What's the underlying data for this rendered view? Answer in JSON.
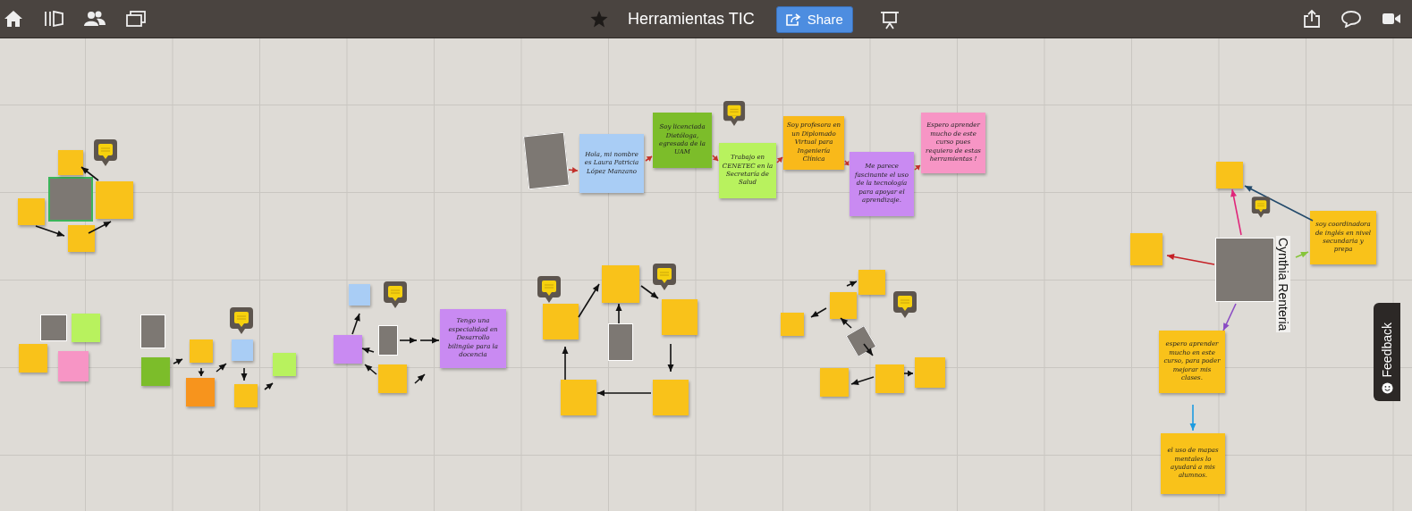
{
  "toolbar": {
    "title": "Herramientas TIC",
    "share_button": "Share"
  },
  "notes": [
    {
      "color": "#a9cdf5",
      "text": "Hola, mi nombre es Laura Patricia López Manzano"
    },
    {
      "color": "#7cbd2a",
      "text": "Soy licenciada Dietóloga, egresada de la UAM"
    },
    {
      "color": "#b8f25e",
      "text": "Trabajo en CENETEC en la Secretaría de Salud"
    },
    {
      "color": "#f9b91a",
      "text": "Soy profesora en un Diplomado Virtual para Ingeniería Clínica"
    },
    {
      "color": "#c98af2",
      "text": "Me parece fascinante el uso de la tecnología para apoyar el aprendizaje."
    },
    {
      "color": "#f795c5",
      "text": "Espero aprender mucho de este curso pues requiero de estas herramientas !"
    },
    {
      "color": "#f9c21a"
    },
    {
      "color": "#f9c21a"
    },
    {
      "color": "#f9c21a"
    },
    {
      "color": "#f9c21a"
    },
    {
      "color": "#b8f25e"
    },
    {
      "color": "#f9c21a"
    },
    {
      "color": "#f795c5"
    },
    {
      "color": "#7cbd2a"
    },
    {
      "color": "#f9c21a"
    },
    {
      "color": "#f7941d"
    },
    {
      "color": "#a9cdf5"
    },
    {
      "color": "#f9c21a"
    },
    {
      "color": "#b8f25e"
    },
    {
      "color": "#a9cdf5"
    },
    {
      "color": "#c98af2"
    },
    {
      "color": "#f9c21a"
    },
    {
      "color": "#c98af2",
      "text": "Tengo una especialidad en Desarrollo bilingüe para la docencia"
    },
    {
      "color": "#f9c21a"
    },
    {
      "color": "#f9c21a"
    },
    {
      "color": "#f9c21a"
    },
    {
      "color": "#f9c21a"
    },
    {
      "color": "#f9c21a"
    },
    {
      "color": "#f9c21a"
    },
    {
      "color": "#f9c21a"
    },
    {
      "color": "#f9c21a"
    },
    {
      "color": "#f9c21a"
    },
    {
      "color": "#f9c21a"
    },
    {
      "color": "#f9c21a"
    },
    {
      "color": "#f9c21a"
    },
    {
      "color": "#f9c21a"
    },
    {
      "color": "#f9c21a",
      "text": "soy coordinadora de inglés en nivel secundaria y prepa"
    },
    {
      "color": "#f9c21a",
      "text": "espero aprender mucho en este curso, para poder mejorar mis clases."
    },
    {
      "color": "#f9c21a",
      "text": "el uso de mapas mentales lo ayudará a mis alumnos."
    }
  ],
  "name_label": "Cynthia Renteria",
  "feedback_tab": "Feedback"
}
